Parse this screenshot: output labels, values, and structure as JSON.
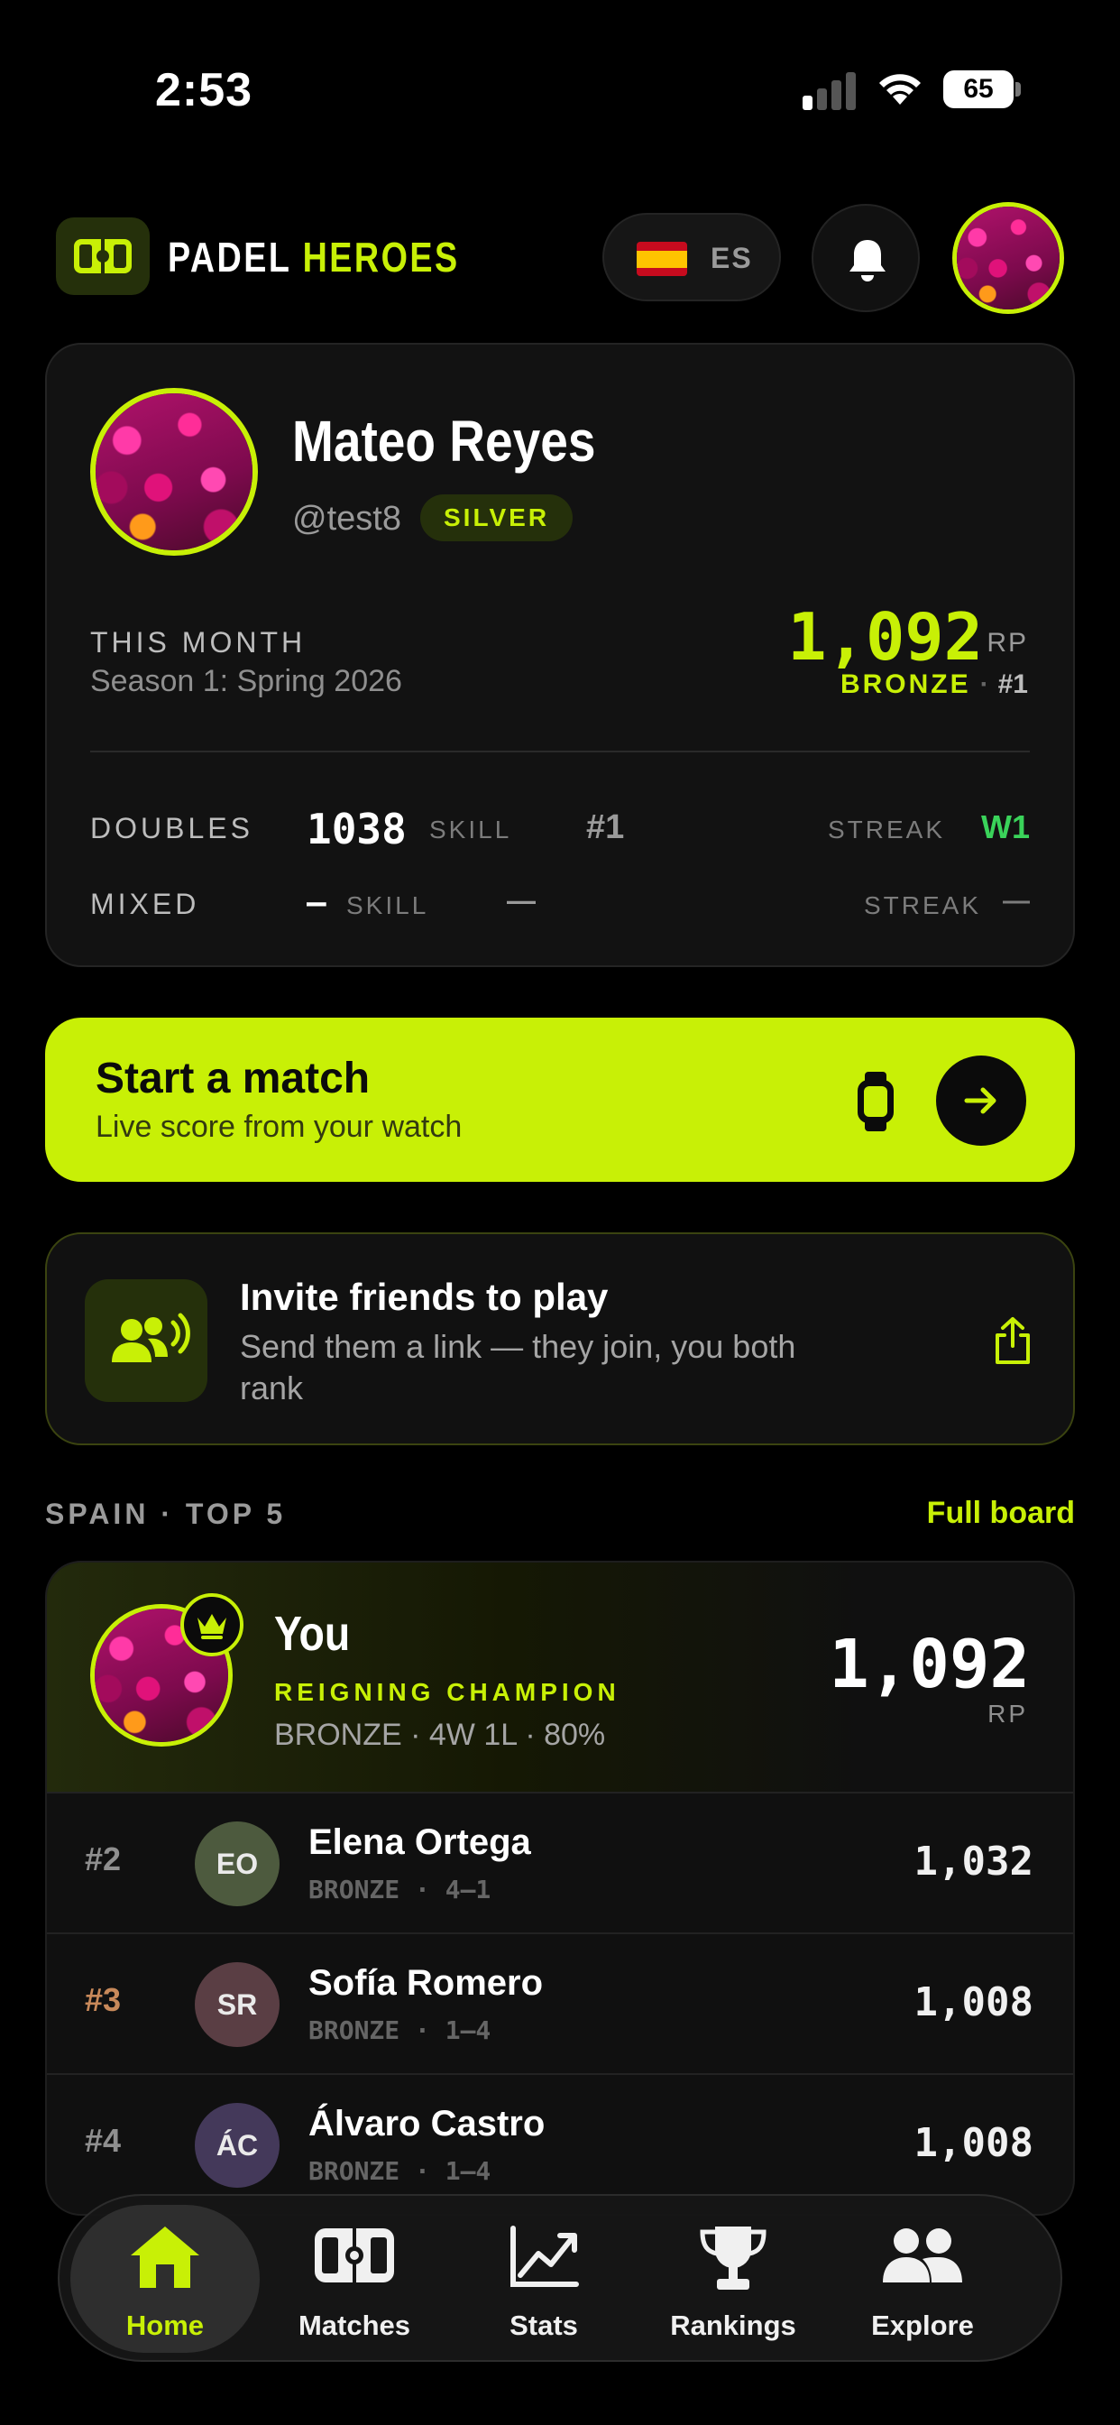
{
  "status_bar": {
    "time": "2:53",
    "battery": "65"
  },
  "brand": {
    "name_part1": "PADEL",
    "name_part2": "HEROES"
  },
  "header": {
    "language_code": "ES"
  },
  "profile": {
    "name": "Mateo Reyes",
    "handle": "@test8",
    "tier_badge": "SILVER",
    "month_label": "THIS MONTH",
    "season": "Season 1: Spring 2026",
    "rp": "1,092",
    "rp_unit": "RP",
    "rank_tier": "BRONZE",
    "rank_separator": "·",
    "rank_position": "#1",
    "stats": [
      {
        "mode": "DOUBLES",
        "skill": "1038",
        "skill_label": "SKILL",
        "rank": "#1",
        "streak_label": "STREAK",
        "streak": "W1"
      },
      {
        "mode": "MIXED",
        "skill": "—",
        "skill_label": "SKILL",
        "rank": "—",
        "streak_label": "STREAK",
        "streak": "—"
      }
    ]
  },
  "start_match": {
    "title": "Start a match",
    "subtitle": "Live score from your watch"
  },
  "invite": {
    "title": "Invite friends to play",
    "subtitle": "Send them a link — they join, you both rank"
  },
  "leaderboard": {
    "title": "SPAIN · TOP 5",
    "full_board_label": "Full board",
    "you": {
      "name": "You",
      "badge": "REIGNING CHAMPION",
      "summary": "BRONZE · 4W 1L · 80%",
      "rp": "1,092",
      "rp_unit": "RP"
    },
    "rows": [
      {
        "rank": "#2",
        "initials": "EO",
        "name": "Elena Ortega",
        "meta": "BRONZE · 4–1",
        "score": "1,032",
        "rank_color": "#8f8f8f",
        "avatar_color": "#4d5a3e"
      },
      {
        "rank": "#3",
        "initials": "SR",
        "name": "Sofía Romero",
        "meta": "BRONZE · 1–4",
        "score": "1,008",
        "rank_color": "#c8895a",
        "avatar_color": "#5a3e44"
      },
      {
        "rank": "#4",
        "initials": "ÁC",
        "name": "Álvaro Castro",
        "meta": "BRONZE · 1–4",
        "score": "1,008",
        "rank_color": "#8f8f8f",
        "avatar_color": "#44395a"
      }
    ]
  },
  "tabs": [
    {
      "label": "Home",
      "icon": "home-icon",
      "active": true
    },
    {
      "label": "Matches",
      "icon": "court-icon",
      "active": false
    },
    {
      "label": "Stats",
      "icon": "chart-icon",
      "active": false
    },
    {
      "label": "Rankings",
      "icon": "trophy-icon",
      "active": false
    },
    {
      "label": "Explore",
      "icon": "people-icon",
      "active": false
    }
  ],
  "colors": {
    "accent": "#c8f006",
    "background": "#000000",
    "card": "#121212",
    "streak": "#3ad35a"
  }
}
